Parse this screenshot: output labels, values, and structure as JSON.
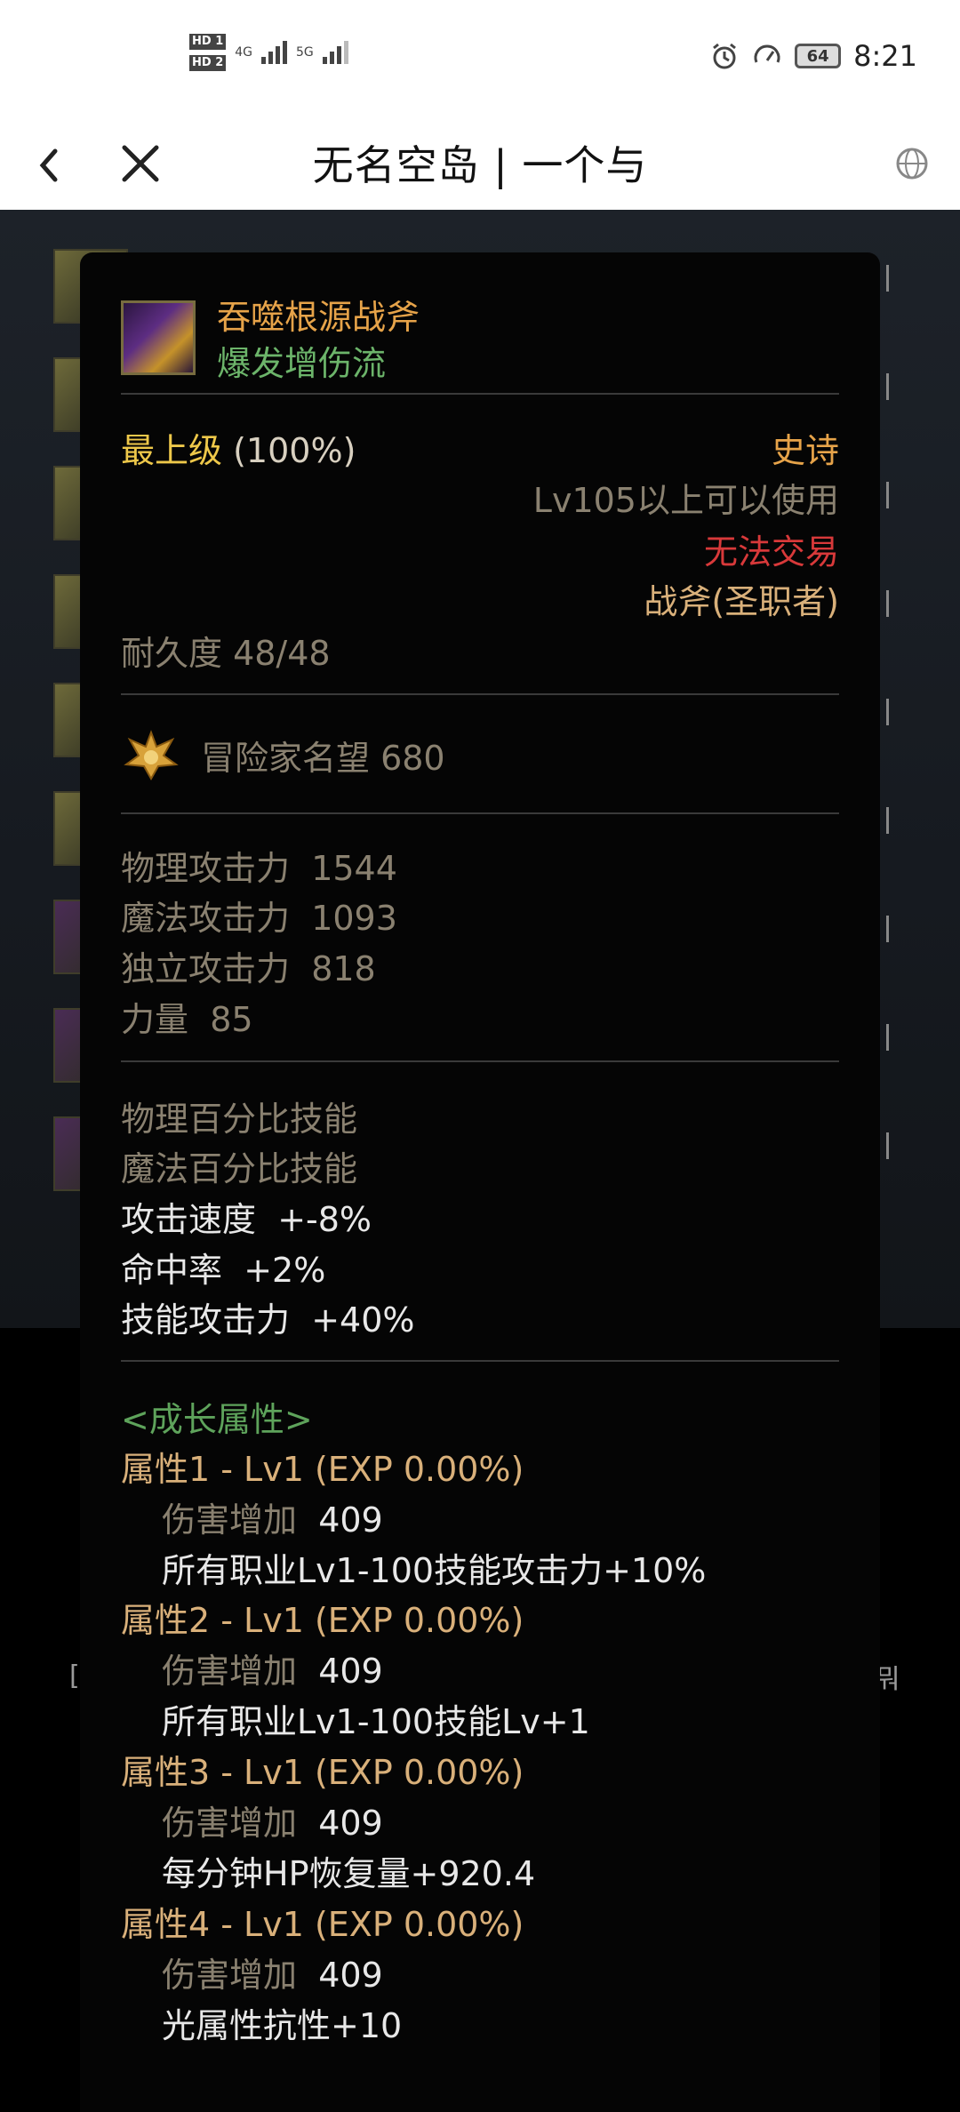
{
  "status_bar": {
    "sim1": "HD 1",
    "sim2": "HD 2",
    "net1": "4G",
    "net2": "5G",
    "battery": "64",
    "time": "8:21"
  },
  "title_bar": {
    "title": "无名空岛 | 一个与"
  },
  "item": {
    "name": "吞噬根源战斧",
    "build": "爆发增伤流",
    "grade_label": "最上级",
    "grade_pct": "(100%)",
    "rarity": "史诗",
    "level_req": "Lv105以上可以使用",
    "trade": "无法交易",
    "weapon_type": "战斧(圣职者)",
    "durability": "耐久度 48/48",
    "fame": "冒险家名望 680",
    "stats": [
      {
        "label": "物理攻击力",
        "value": "1544"
      },
      {
        "label": "魔法攻击力",
        "value": "1093"
      },
      {
        "label": "独立攻击力",
        "value": "818"
      },
      {
        "label": "力量",
        "value": "85"
      }
    ],
    "skill_lines": [
      {
        "label": "物理百分比技能",
        "value": ""
      },
      {
        "label": "魔法百分比技能",
        "value": ""
      },
      {
        "label": "攻击速度",
        "value": "+-8%"
      },
      {
        "label": "命中率",
        "value": "+2%"
      },
      {
        "label": "技能攻击力",
        "value": "+40%"
      }
    ],
    "growth_header": "<成长属性>",
    "growth": [
      {
        "title": "属性1 - Lv1 (EXP 0.00%)",
        "dmg_label": "伤害增加",
        "dmg_value": "409",
        "effect": "所有职业Lv1-100技能攻击力+10%"
      },
      {
        "title": "属性2 - Lv1 (EXP 0.00%)",
        "dmg_label": "伤害增加",
        "dmg_value": "409",
        "effect": "所有职业Lv1-100技能Lv+1"
      },
      {
        "title": "属性3 - Lv1 (EXP 0.00%)",
        "dmg_label": "伤害增加",
        "dmg_value": "409",
        "effect": "每分钟HP恢复量+920.4"
      },
      {
        "title": "属性4 - Lv1 (EXP 0.00%)",
        "dmg_label": "伤害增加",
        "dmg_value": "409",
        "effect": "光属性抗性+10"
      }
    ]
  },
  "background": {
    "left_bracket": "[",
    "right_glyph": "뭐"
  },
  "colors": {
    "name": "#e6a349",
    "build": "#6cb46a",
    "grade": "#eec84a",
    "trade": "#d8393a",
    "stat": "#8a8170",
    "growth_header": "#5ea35b",
    "growth_title": "#d9b07a"
  }
}
